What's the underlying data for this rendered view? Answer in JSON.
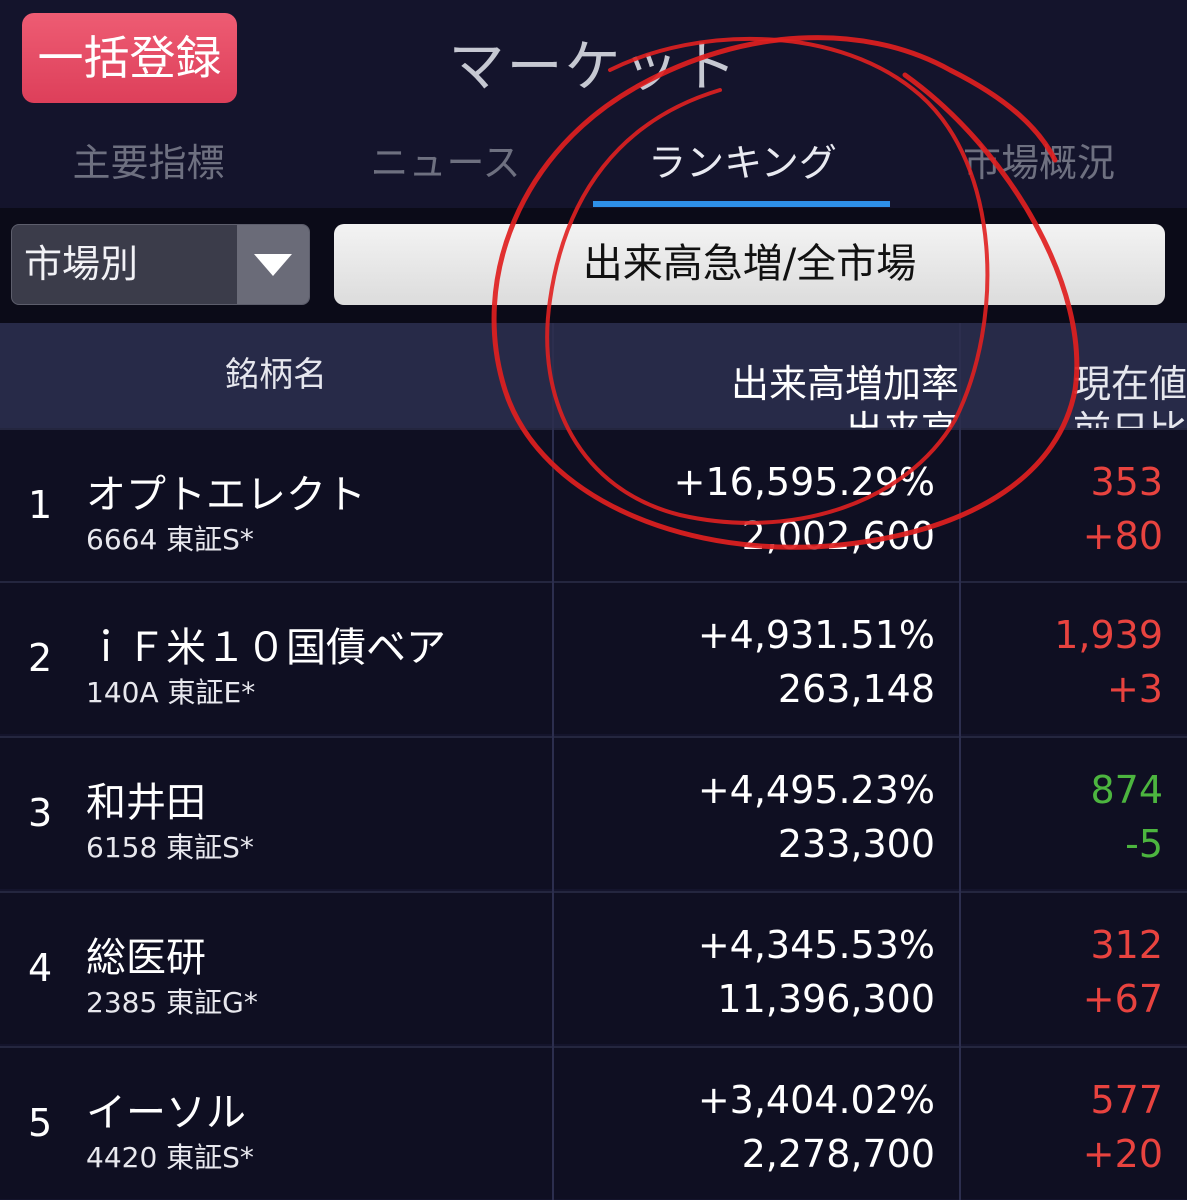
{
  "header": {
    "bulk_button": "一括登録",
    "title": "マーケット"
  },
  "tabs": [
    {
      "label": "主要指標",
      "active": false
    },
    {
      "label": "ニュース",
      "active": false
    },
    {
      "label": "ランキング",
      "active": true
    },
    {
      "label": "市場概況",
      "active": false
    }
  ],
  "filter": {
    "select_value": "市場別",
    "ranking_type": "出来高急増/全市場"
  },
  "columns": {
    "name": "銘柄名",
    "rate": "出来高増加率",
    "volume": "出来高",
    "price": "現在値",
    "change": "前日比"
  },
  "rows": [
    {
      "rank": "1",
      "name": "オプトエレクト",
      "code": "6664 東証S*",
      "rate": "+16,595.29%",
      "volume": "2,002,600",
      "price": "353",
      "change": "+80",
      "direction": "up"
    },
    {
      "rank": "2",
      "name": "ｉＦ米１０国債ベア",
      "code": "140A 東証E*",
      "rate": "+4,931.51%",
      "volume": "263,148",
      "price": "1,939",
      "change": "+3",
      "direction": "up"
    },
    {
      "rank": "3",
      "name": "和井田",
      "code": "6158 東証S*",
      "rate": "+4,495.23%",
      "volume": "233,300",
      "price": "874",
      "change": "-5",
      "direction": "down"
    },
    {
      "rank": "4",
      "name": "総医研",
      "code": "2385 東証G*",
      "rate": "+4,345.53%",
      "volume": "11,396,300",
      "price": "312",
      "change": "+67",
      "direction": "up"
    },
    {
      "rank": "5",
      "name": "イーソル",
      "code": "4420 東証S*",
      "rate": "+3,404.02%",
      "volume": "2,278,700",
      "price": "577",
      "change": "+20",
      "direction": "up"
    }
  ],
  "colors": {
    "up": "#e8433f",
    "down": "#4cb53f",
    "accent": "#2e90e8",
    "annotation": "#e02020"
  }
}
